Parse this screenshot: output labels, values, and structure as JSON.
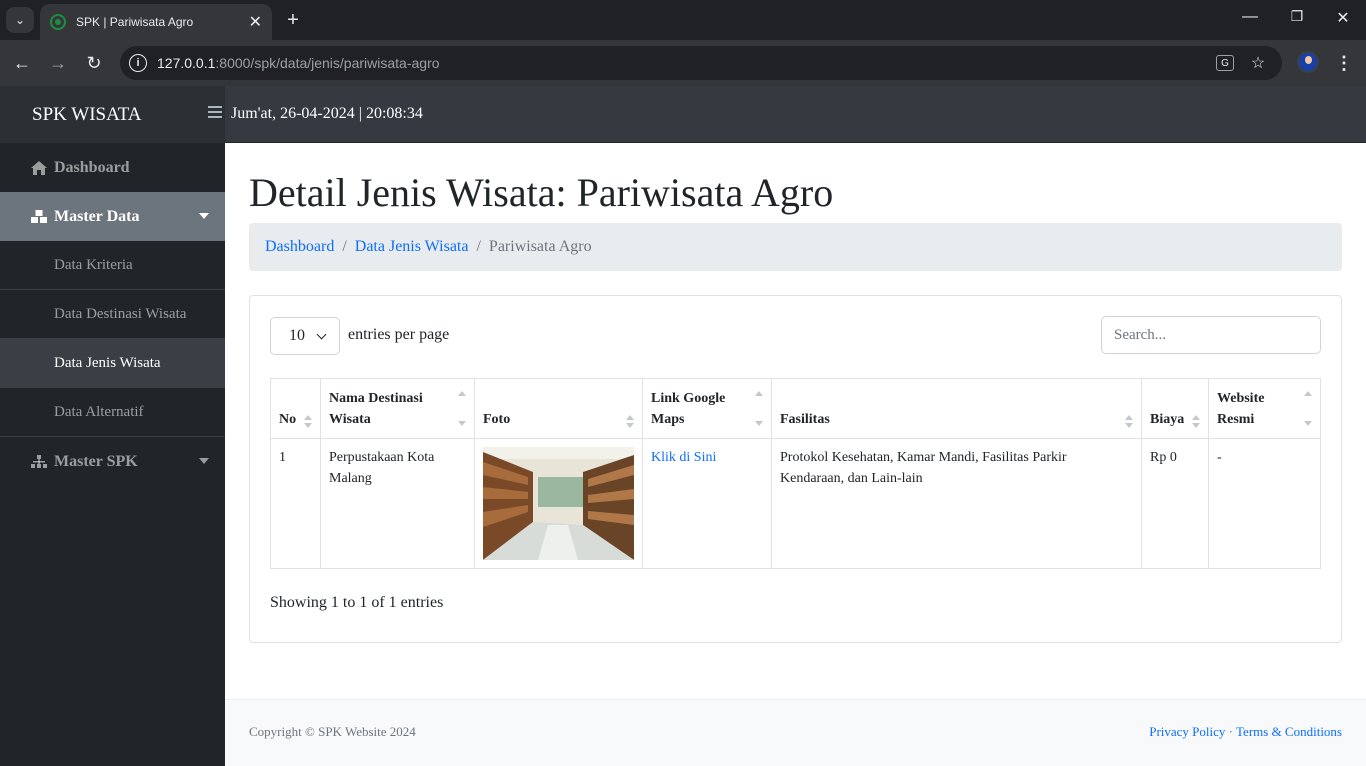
{
  "browser": {
    "tab_title": "SPK | Pariwisata Agro",
    "tab_close": "✕",
    "new_tab": "+",
    "url_host": "127.0.0.1",
    "url_rest": ":8000/spk/data/jenis/pariwisata-agro",
    "window_controls": [
      "—",
      "❐",
      "✕"
    ]
  },
  "navbar": {
    "brand": "SPK WISATA",
    "datetime": "Jum'at, 26-04-2024 | 20:08:34"
  },
  "sidebar": {
    "dashboard": "Dashboard",
    "master_data": "Master Data",
    "sub_items": [
      "Data Kriteria",
      "Data Destinasi Wisata",
      "Data Jenis Wisata",
      "Data Alternatif"
    ],
    "master_spk": "Master SPK"
  },
  "main": {
    "title": "Detail Jenis Wisata: Pariwisata Agro",
    "breadcrumb": [
      "Dashboard",
      "Data Jenis Wisata",
      "Pariwisata Agro"
    ],
    "breadcrumb_sep": "/",
    "per_page_value": "10",
    "per_page_label": "entries per page",
    "search_placeholder": "Search...",
    "table": {
      "headers": [
        "No",
        "Nama Destinasi Wisata",
        "Foto",
        "Link Google Maps",
        "Fasilitas",
        "Biaya",
        "Website Resmi"
      ],
      "rows": [
        {
          "no": "1",
          "nama": "Perpustakaan Kota Malang",
          "link": "Klik di Sini",
          "fasilitas": "Protokol Kesehatan, Kamar Mandi, Fasilitas Parkir Kendaraan, dan Lain-lain",
          "biaya": "Rp 0",
          "website": "-"
        }
      ]
    },
    "showing": "Showing 1 to 1 of 1 entries"
  },
  "footer": {
    "copyright": "Copyright © SPK Website 2024",
    "privacy": "Privacy Policy",
    "dot": "·",
    "terms": "Terms & Conditions"
  },
  "colors": {
    "navbar": "#343a40",
    "sidebar": "#212529",
    "active": "#6c757d",
    "link": "#0d6efd"
  }
}
